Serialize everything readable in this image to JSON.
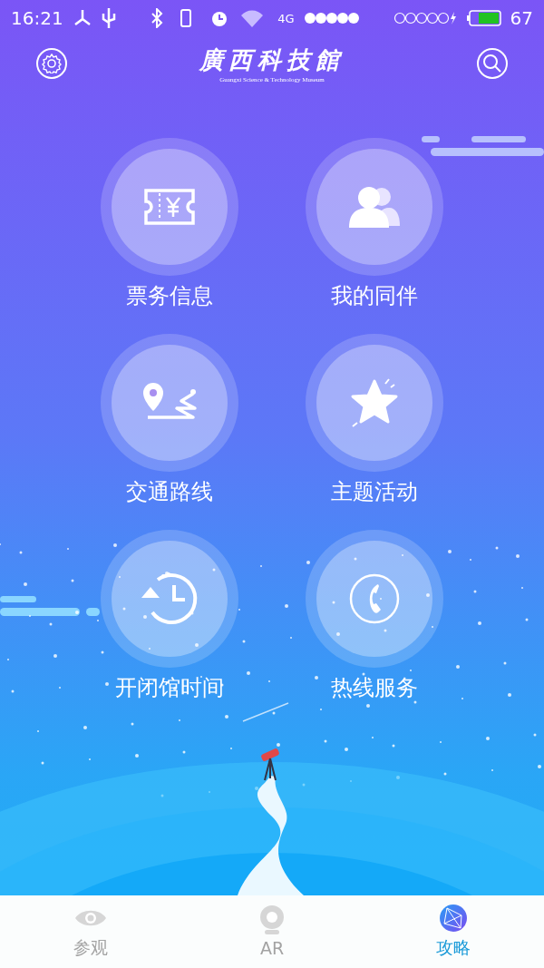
{
  "status_bar": {
    "time": "16:21",
    "network": "4G",
    "battery": "67"
  },
  "header": {
    "title": "廣西科技館",
    "subtitle": "Guangxi Science & Technology Museum"
  },
  "menu": [
    {
      "label": "票务信息"
    },
    {
      "label": "我的同伴"
    },
    {
      "label": "交通路线"
    },
    {
      "label": "主题活动"
    },
    {
      "label": "开闭馆时间"
    },
    {
      "label": "热线服务"
    }
  ],
  "tabs": [
    {
      "label": "参观",
      "selected": false
    },
    {
      "label": "AR",
      "selected": false
    },
    {
      "label": "攻略",
      "selected": true
    }
  ]
}
